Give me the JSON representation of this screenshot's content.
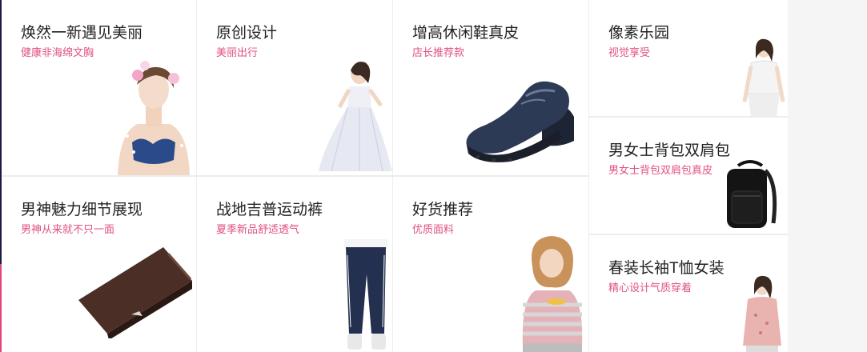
{
  "cards": [
    {
      "title": "焕然一新遇见美丽",
      "subtitle": "健康非海绵文胸",
      "image": "lingerie-model-photo"
    },
    {
      "title": "原创设计",
      "subtitle": "美丽出行",
      "image": "white-dress-model-photo"
    },
    {
      "title": "增高休闲鞋真皮",
      "subtitle": "店长推荐款",
      "image": "navy-leather-shoe-photo"
    },
    {
      "title": "像素乐园",
      "subtitle": "视觉享受",
      "image": "white-blouse-model-photo"
    },
    {
      "title": "男女士背包双肩包",
      "subtitle": "男女士背包双肩包真皮",
      "image": "black-backpack-photo"
    },
    {
      "title": "男神魅力细节展现",
      "subtitle": "男神从来就不只一面",
      "image": "brown-wallet-photo"
    },
    {
      "title": "战地吉普运动裤",
      "subtitle": "夏季新品舒适透气",
      "image": "navy-sweatpants-photo"
    },
    {
      "title": "好货推荐",
      "subtitle": "优质面料",
      "image": "striped-sweater-girl-photo"
    },
    {
      "title": "春装长袖T恤女装",
      "subtitle": "精心设计气质穿着",
      "image": "pink-tshirt-model-photo"
    }
  ],
  "colors": {
    "title": "#222222",
    "subtitle": "#e0517f",
    "card_bg": "#ffffff",
    "divider": "#ededed"
  }
}
